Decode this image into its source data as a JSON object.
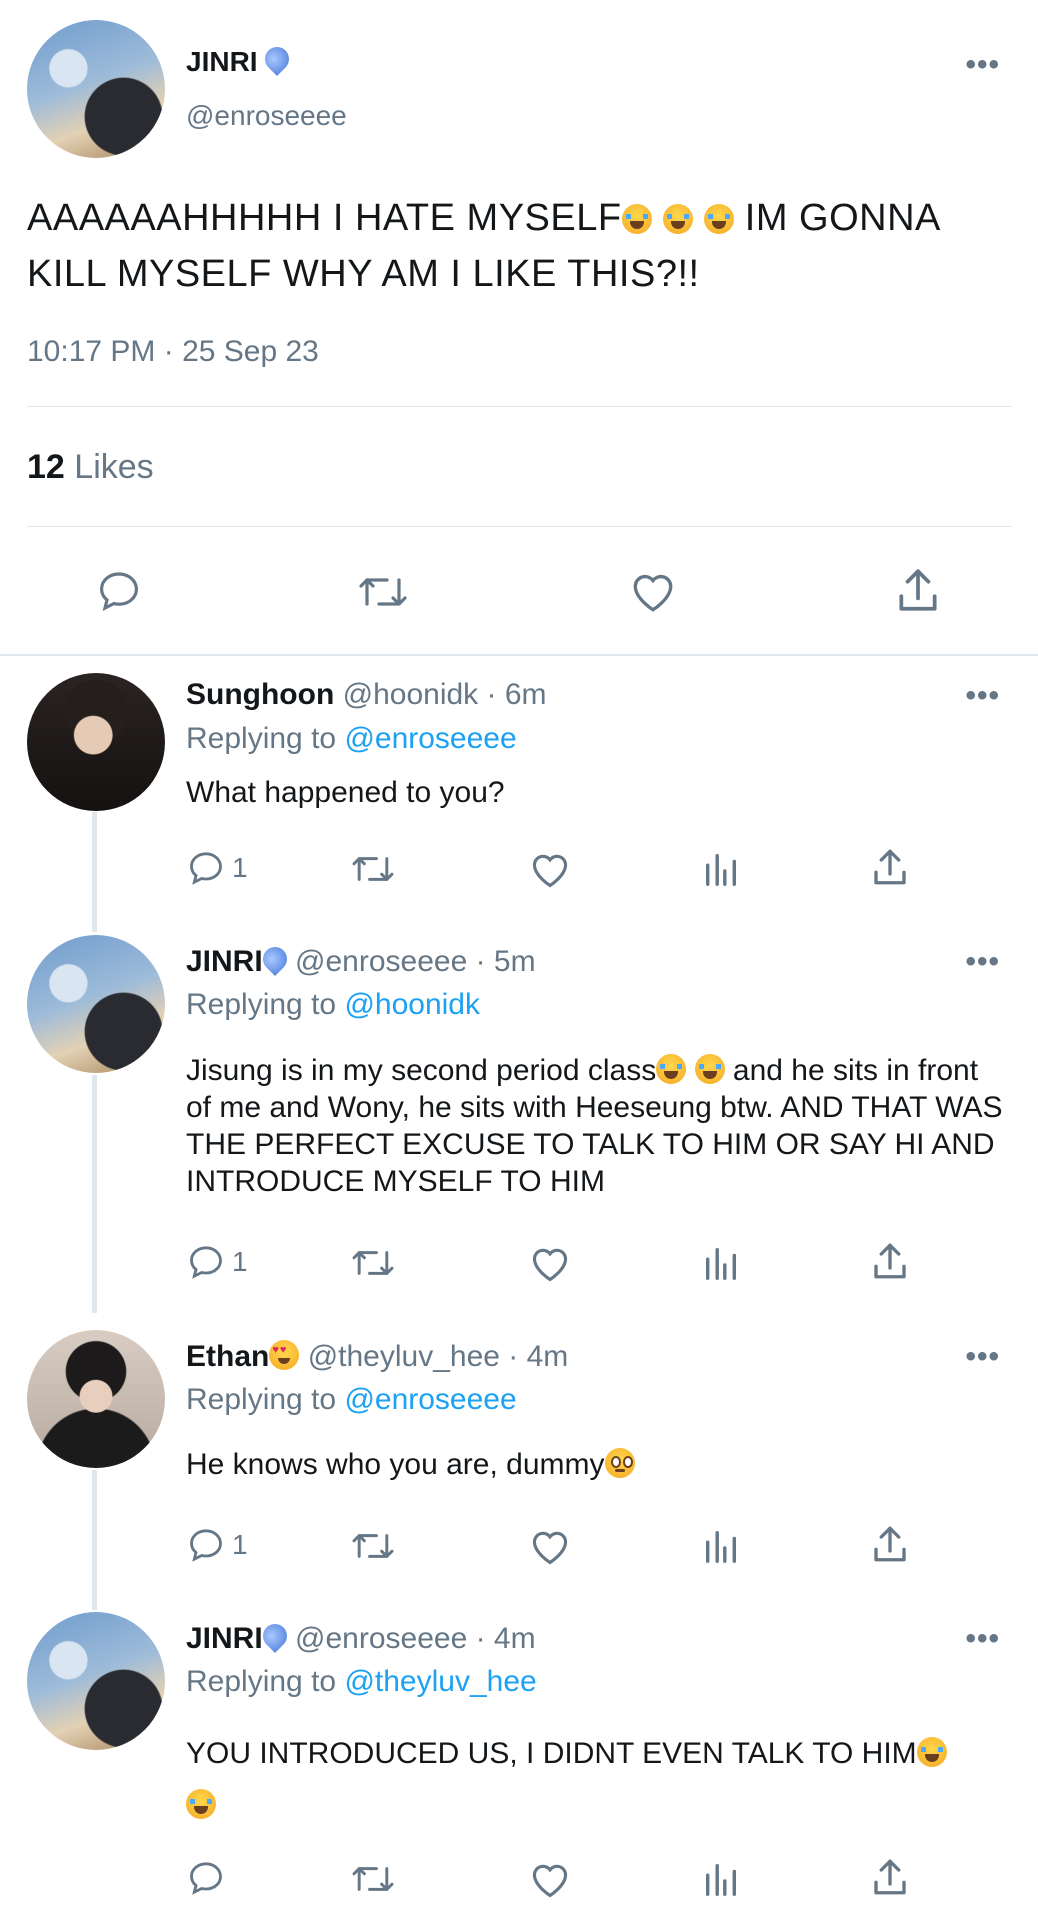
{
  "main_tweet": {
    "name": "JINRI",
    "handle": "@enroseeee",
    "text_part1": "AAAAAAHHHHH I HATE MYSELF",
    "text_part2": " IM GONNA KILL MYSELF WHY AM I LIKE THIS?!!",
    "timestamp": "10:17 PM · 25 Sep 23",
    "likes_count": "12",
    "likes_label": "Likes"
  },
  "replies": [
    {
      "name": "Sunghoon",
      "handle": "@hoonidk · 6m",
      "replying_label": "Replying to",
      "replying_to": "@enroseeee",
      "text": "What happened to you?",
      "reply_count": "1"
    },
    {
      "name": "JINRI",
      "handle": "@enroseeee · 5m",
      "replying_label": "Replying to",
      "replying_to": "@hoonidk",
      "text_part1": "Jisung is in my second period class",
      "text_part2": " and he sits in front of me and Wony, he sits with Heeseung btw. AND THAT WAS THE PERFECT EXCUSE TO TALK TO HIM OR SAY HI AND INTRODUCE MYSELF TO HIM",
      "reply_count": "1"
    },
    {
      "name": "Ethan",
      "handle": "@theyluv_hee · 4m",
      "replying_label": "Replying to",
      "replying_to": "@enroseeee",
      "text": "He knows who you are, dummy",
      "reply_count": "1"
    },
    {
      "name": "JINRI",
      "handle": "@enroseeee · 4m",
      "replying_label": "Replying to",
      "replying_to": "@theyluv_hee",
      "text": "YOU INTRODUCED US, I DIDNT EVEN TALK TO HIM",
      "reply_count": ""
    }
  ],
  "more_label": "•••",
  "colors": {
    "link": "#1da1f2",
    "muted": "#657786",
    "divider": "#e1e8ed",
    "text": "#14171a"
  },
  "icons": [
    "reply-icon",
    "retweet-icon",
    "like-icon",
    "analytics-icon",
    "share-icon",
    "more-icon"
  ]
}
